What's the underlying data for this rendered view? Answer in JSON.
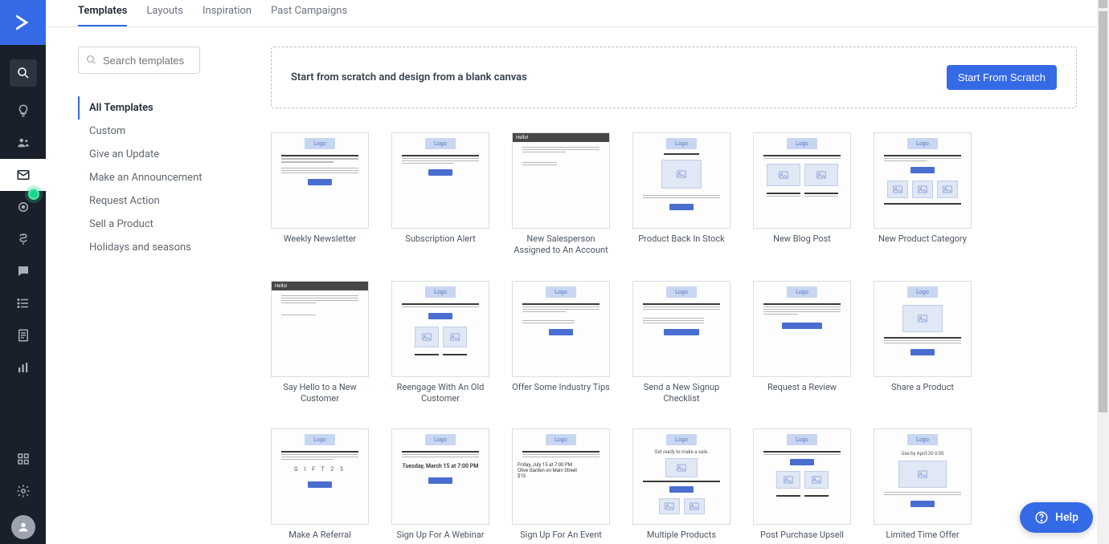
{
  "sidebar": {
    "logo_name": "activecampaign-logo"
  },
  "tabs": [
    {
      "label": "Templates",
      "active": true
    },
    {
      "label": "Layouts",
      "active": false
    },
    {
      "label": "Inspiration",
      "active": false
    },
    {
      "label": "Past Campaigns",
      "active": false
    }
  ],
  "search": {
    "placeholder": "Search templates"
  },
  "categories": [
    {
      "label": "All Templates",
      "active": true
    },
    {
      "label": "Custom",
      "active": false
    },
    {
      "label": "Give an Update",
      "active": false
    },
    {
      "label": "Make an Announcement",
      "active": false
    },
    {
      "label": "Request Action",
      "active": false
    },
    {
      "label": "Sell a Product",
      "active": false
    },
    {
      "label": "Holidays and seasons",
      "active": false
    }
  ],
  "scratch": {
    "text": "Start from scratch and design from a blank canvas",
    "button": "Start From Scratch"
  },
  "templates": [
    {
      "label": "Weekly Newsletter"
    },
    {
      "label": "Subscription Alert"
    },
    {
      "label": "New Salesperson Assigned to An Account"
    },
    {
      "label": "Product Back In Stock"
    },
    {
      "label": "New Blog Post"
    },
    {
      "label": "New Product Category"
    },
    {
      "label": "Say Hello to a New Customer"
    },
    {
      "label": "Reengage With An Old Customer"
    },
    {
      "label": "Offer Some Industry Tips"
    },
    {
      "label": "Send a New Signup Checklist"
    },
    {
      "label": "Request a Review"
    },
    {
      "label": "Share a Product"
    },
    {
      "label": "Make A Referral"
    },
    {
      "label": "Sign Up For A Webinar"
    },
    {
      "label": "Sign Up For An Event"
    },
    {
      "label": "Multiple Products"
    },
    {
      "label": "Post Purchase Upsell"
    },
    {
      "label": "Limited Time Offer"
    }
  ],
  "thumb_logo": "Logo",
  "help": {
    "label": "Help"
  },
  "colors": {
    "accent": "#356ae6",
    "sidebar": "#19202b"
  }
}
